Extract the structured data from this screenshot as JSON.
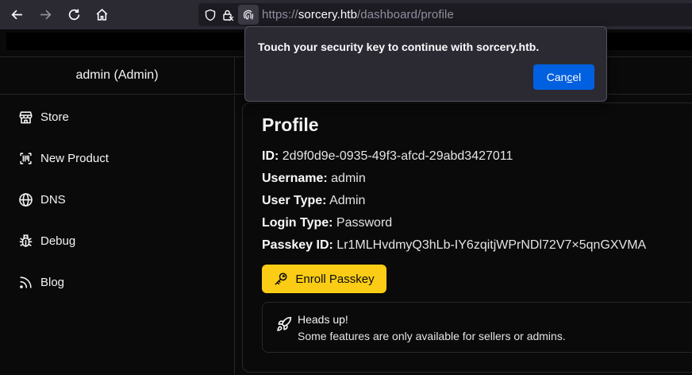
{
  "browser": {
    "url_scheme": "https://",
    "url_host": "sorcery.htb",
    "url_path": "/dashboard/profile"
  },
  "popup": {
    "message": "Touch your security key to continue with sorcery.htb.",
    "cancel_pre": "Can",
    "cancel_accel": "c",
    "cancel_post": "el"
  },
  "header": {
    "user": "admin (Admin)"
  },
  "sidebar": {
    "items": [
      {
        "label": "Store",
        "icon": "store-icon"
      },
      {
        "label": "New Product",
        "icon": "new-product-icon"
      },
      {
        "label": "DNS",
        "icon": "globe-icon"
      },
      {
        "label": "Debug",
        "icon": "bug-icon"
      },
      {
        "label": "Blog",
        "icon": "rss-icon"
      }
    ]
  },
  "profile": {
    "title": "Profile",
    "fields": [
      {
        "key": "ID:",
        "value": "2d9f0d9e-0935-49f3-afcd-29abd3427011"
      },
      {
        "key": "Username:",
        "value": "admin"
      },
      {
        "key": "User Type:",
        "value": "Admin"
      },
      {
        "key": "Login Type:",
        "value": "Password"
      },
      {
        "key": "Passkey ID:",
        "value": "Lr1MLHvdmyQ3hLb-IY6zqitjWPrNDl72V7×5qnGXVMA"
      }
    ],
    "enroll_label": "Enroll Passkey"
  },
  "alert": {
    "title": "Heads up!",
    "description": "Some features are only available for sellers or admins."
  },
  "colors": {
    "accent_yellow": "#facc15",
    "popup_button": "#0060df",
    "background": "#0a0a0a"
  }
}
